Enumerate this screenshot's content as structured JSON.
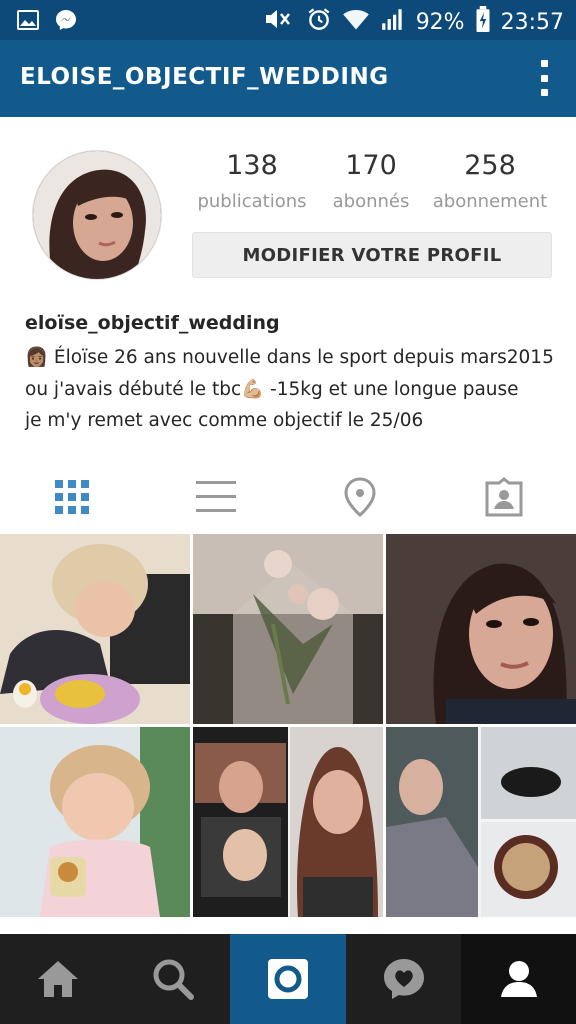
{
  "status_bar": {
    "battery": "92%",
    "time": "23:57",
    "left_icons": [
      "gallery-icon",
      "messenger-icon"
    ],
    "right_icons": [
      "mute-icon",
      "alarm-icon",
      "wifi-icon",
      "signal-icon",
      "battery-icon"
    ]
  },
  "app_bar": {
    "title": "ELOISE_OBJECTIF_WEDDING",
    "menu_icon": "overflow-menu-icon"
  },
  "profile": {
    "stats": [
      {
        "value": "138",
        "label": "publications"
      },
      {
        "value": "170",
        "label": "abonnés"
      },
      {
        "value": "258",
        "label": "abonnement"
      }
    ],
    "edit_button": "MODIFIER VOTRE PROFIL",
    "username": "eloïse_objectif_wedding",
    "bio_lines": [
      "👩🏽 Éloïse 26 ans nouvelle dans le sport depuis mars2015",
      "ou j'avais débuté le tbc💪🏼 -15kg et une longue pause",
      "je m'y remet avec comme objectif le 25/06"
    ]
  },
  "tabs": [
    {
      "icon": "grid-icon",
      "active": true
    },
    {
      "icon": "list-icon",
      "active": false
    },
    {
      "icon": "location-pin-icon",
      "active": false
    },
    {
      "icon": "tagged-photos-icon",
      "active": false
    }
  ],
  "posts": [
    {
      "name": "post-child-eating"
    },
    {
      "name": "post-flowers-vase"
    },
    {
      "name": "post-selfie"
    },
    {
      "name": "post-toddler-snack"
    },
    {
      "name": "post-screenshot-collage"
    },
    {
      "name": "post-cat-coffee-collage"
    }
  ],
  "bottom_nav": [
    {
      "icon": "home-icon",
      "active": false
    },
    {
      "icon": "search-icon",
      "active": false
    },
    {
      "icon": "camera-icon",
      "active": false
    },
    {
      "icon": "activity-heart-icon",
      "active": false
    },
    {
      "icon": "profile-icon",
      "active": true
    }
  ],
  "colors": {
    "status_bar": "#0d4a79",
    "app_bar": "#135a8c",
    "camera_tab": "#135a8c",
    "active_tab": "#3f8ac6",
    "bottom_nav": "#1f1f1f"
  }
}
